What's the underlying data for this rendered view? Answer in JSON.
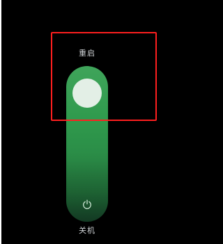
{
  "labels": {
    "restart": "重启",
    "power_off": "关机"
  },
  "slider": {
    "thumb_position": "top"
  },
  "icons": {
    "power": "power-icon"
  },
  "colors": {
    "background": "#000000",
    "track_top": "#3fa45a",
    "track_bottom": "#17462a",
    "thumb": "#e3efe6",
    "highlight": "#ff1f1f"
  }
}
